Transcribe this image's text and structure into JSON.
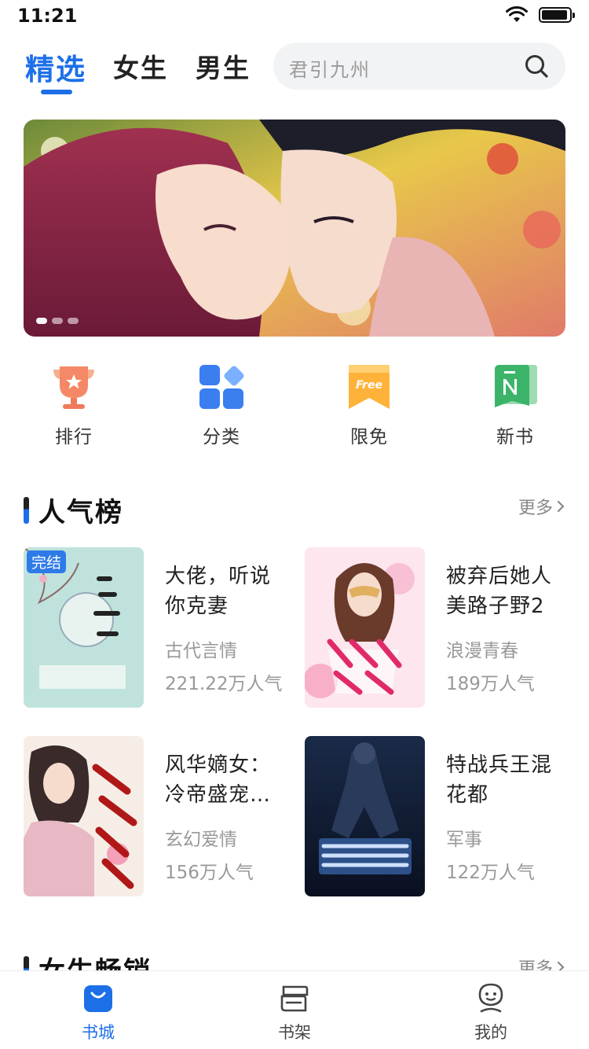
{
  "status_bar": {
    "time": "11:21",
    "battery_level": 0.95
  },
  "top_tabs": [
    {
      "label": "精选",
      "active": true
    },
    {
      "label": "女生",
      "active": false
    },
    {
      "label": "男生",
      "active": false
    }
  ],
  "search": {
    "placeholder": "君引九州",
    "icon": "search-icon"
  },
  "banner": {
    "dot_count": 3,
    "active_dot": 1
  },
  "quick_entries": [
    {
      "label": "排行",
      "icon": "trophy-icon",
      "color": "#f07a5a"
    },
    {
      "label": "分类",
      "icon": "category-grid-icon",
      "color": "#3a7ef0"
    },
    {
      "label": "限免",
      "icon": "free-ribbon-icon",
      "color": "#ffb23a"
    },
    {
      "label": "新书",
      "icon": "new-book-icon",
      "color": "#3bb46a"
    }
  ],
  "popular_section": {
    "title": "人气榜",
    "more_label": "更多",
    "books": [
      {
        "title": "大佬，听说你克妻",
        "genre": "古代言情",
        "popularity": "221.22万人气",
        "badge": "完结"
      },
      {
        "title": "被弃后她人美路子野2",
        "genre": "浪漫青春",
        "popularity": "189万人气",
        "badge": ""
      },
      {
        "title": "风华嫡女：冷帝盛宠…",
        "genre": "玄幻爱情",
        "popularity": "156万人气",
        "badge": ""
      },
      {
        "title": "特战兵王混花都",
        "genre": "军事",
        "popularity": "122万人气",
        "badge": ""
      }
    ]
  },
  "next_section": {
    "title": "女生畅销",
    "more_label": "更多"
  },
  "bottom_nav": [
    {
      "label": "书城",
      "icon": "bookstore-bag-icon",
      "active": true
    },
    {
      "label": "书架",
      "icon": "bookshelf-icon",
      "active": false
    },
    {
      "label": "我的",
      "icon": "profile-face-icon",
      "active": false
    }
  ],
  "colors": {
    "accent": "#1d6fe8",
    "muted_text": "#999999",
    "badge": "#2e7be8"
  }
}
